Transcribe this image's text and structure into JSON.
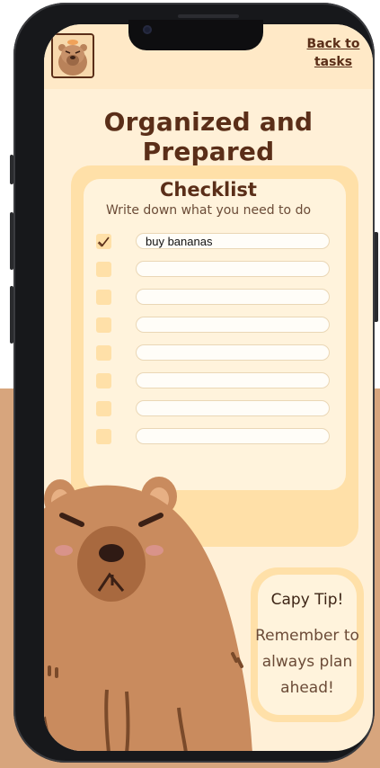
{
  "header": {
    "back_link": "Back to tasks"
  },
  "page": {
    "title": "Organized and Prepared"
  },
  "checklist": {
    "title": "Checklist",
    "subtitle": "Write down what you need to do",
    "items": [
      {
        "checked": true,
        "value": "buy bananas"
      },
      {
        "checked": false,
        "value": ""
      },
      {
        "checked": false,
        "value": ""
      },
      {
        "checked": false,
        "value": ""
      },
      {
        "checked": false,
        "value": ""
      },
      {
        "checked": false,
        "value": ""
      },
      {
        "checked": false,
        "value": ""
      },
      {
        "checked": false,
        "value": ""
      }
    ]
  },
  "tip": {
    "title": "Capy Tip!",
    "body": "Remember to always plan ahead!"
  },
  "colors": {
    "background": "#fff0d7",
    "accent": "#ffe0a8",
    "text": "#5a2e18",
    "capybara": "#c98b5e"
  },
  "icons": [
    "capybara-avatar-icon",
    "check-icon"
  ]
}
